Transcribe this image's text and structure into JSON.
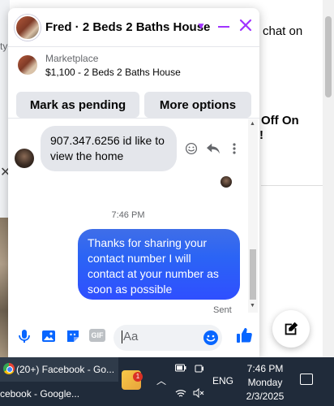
{
  "background": {
    "chat_on_text": "chat on",
    "off_on_text": "Off On",
    "exclaim_text": "!",
    "ty_text": "ty"
  },
  "chat": {
    "title": "Fred · 2 Beds 2 Baths House",
    "listing": {
      "source": "Marketplace",
      "price_title": "$1,100 - 2 Beds 2 Baths House"
    },
    "buttons": {
      "mark_pending": "Mark as pending",
      "more_options": "More options"
    },
    "messages": {
      "incoming": "907.347.6256 id like to view the home",
      "timestamp": "7:46 PM",
      "outgoing": "Thanks for sharing your contact number I will contact at your number as soon as possible",
      "status": "Sent"
    },
    "composer": {
      "placeholder": "Aa",
      "gif_label": "GIF"
    },
    "colors": {
      "accent": "#a033ff",
      "outgoing_bubble": "#2b64f5",
      "messenger_blue": "#0866ff"
    }
  },
  "taskbar": {
    "facebook_window": "(20+) Facebook - Go...",
    "facebook_window_2": "cebook - Google...",
    "badge_count": "1",
    "language": "ENG",
    "time": "7:46 PM",
    "day": "Monday",
    "date": "2/3/2025"
  }
}
